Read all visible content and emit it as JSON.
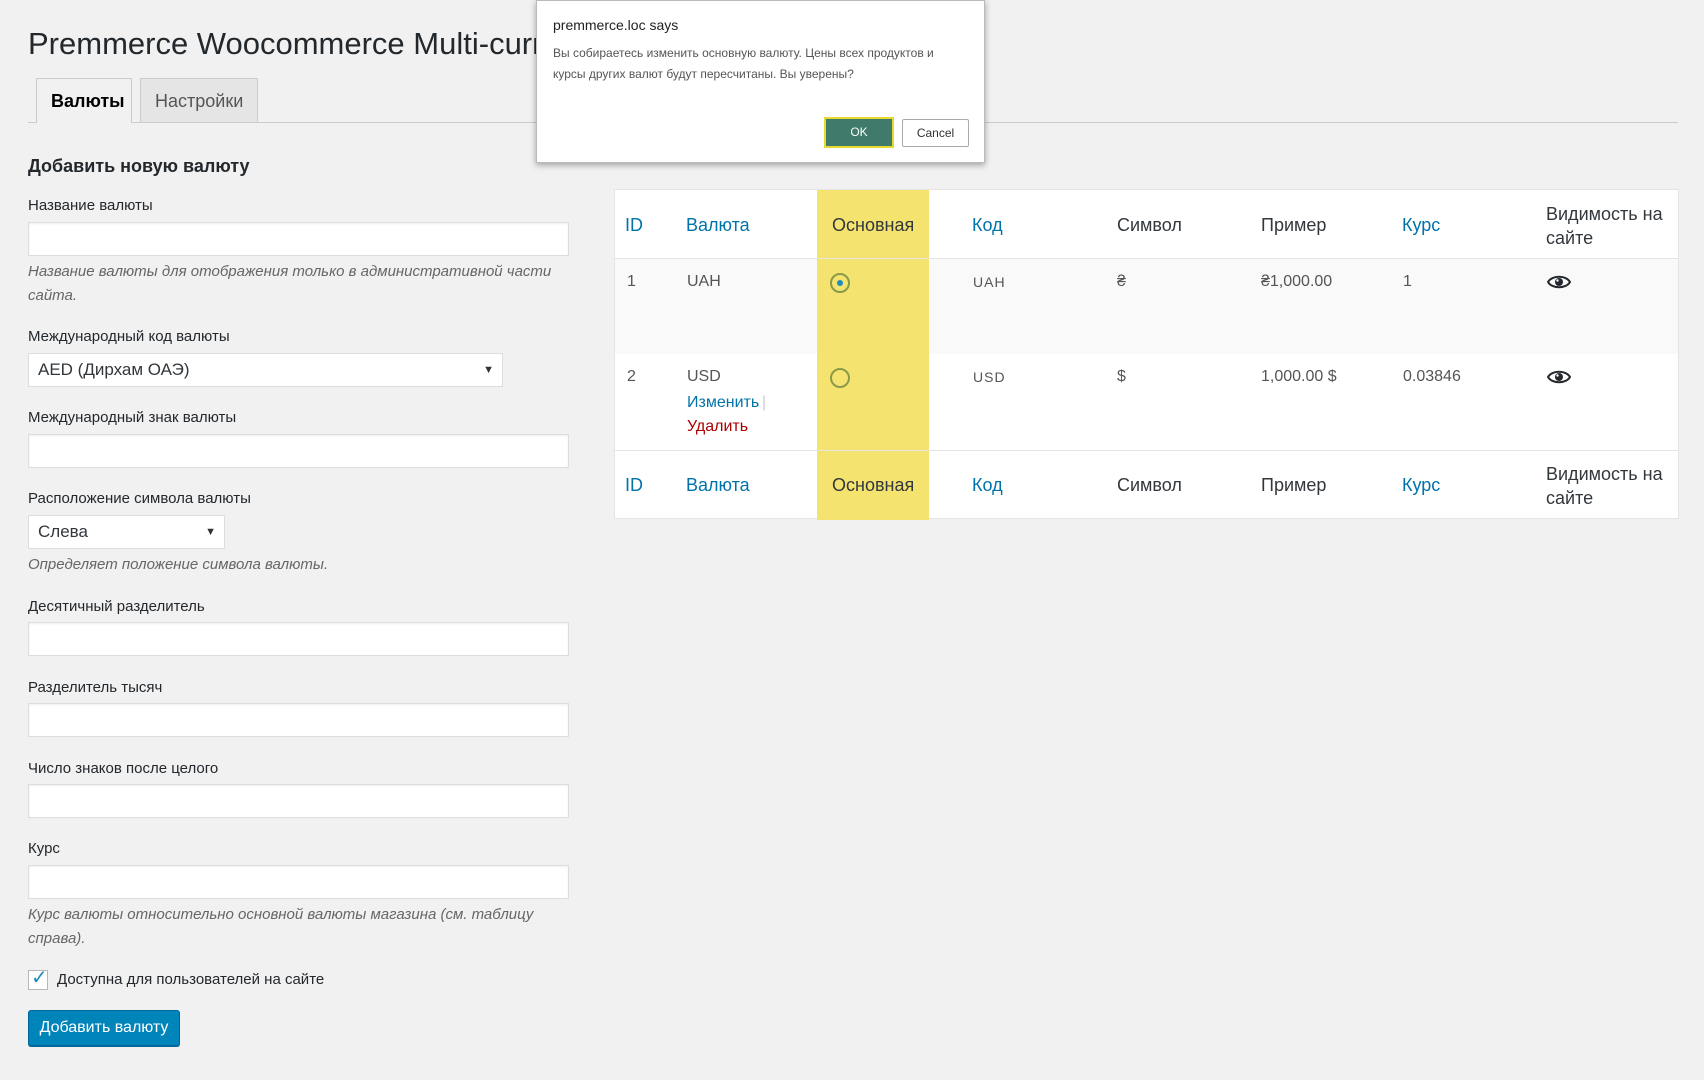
{
  "page": {
    "title": "Premmerce Woocommerce Multi-currency",
    "tabs": [
      {
        "label": "Валюты",
        "active": true
      },
      {
        "label": "Настройки",
        "active": false
      }
    ]
  },
  "form": {
    "heading": "Добавить новую валюту",
    "name_label": "Название валюты",
    "name_value": "",
    "name_desc": "Название валюты для отображения только в административной части сайта.",
    "code_label": "Международный код валюты",
    "code_value": "AED (Дирхам ОАЭ)",
    "symbol_label": "Международный знак валюты",
    "symbol_value": "",
    "position_label": "Расположение символа валюты",
    "position_value": "Слева",
    "position_desc": "Определяет положение символа валюты.",
    "decimal_label": "Десятичный разделитель",
    "thousand_label": "Разделитель тысяч",
    "decimals_label": "Число знаков после целого",
    "rate_label": "Курс",
    "rate_desc": "Курс валюты относительно основной валюты магазина (см. таблицу справа).",
    "available_label": "Доступна для пользователей на сайте",
    "available_checked": true,
    "submit_label": "Добавить валюту"
  },
  "table": {
    "columns": [
      "ID",
      "Валюта",
      "Основная",
      "Код",
      "Символ",
      "Пример",
      "Курс",
      "Видимость на сайте"
    ],
    "rows": [
      {
        "id": "1",
        "currency": "UAH",
        "main": true,
        "code": "UAH",
        "symbol": "₴",
        "example": "₴1,000.00",
        "rate": "1",
        "visible": "eye-icon"
      },
      {
        "id": "2",
        "currency": "USD",
        "main": false,
        "code": "USD",
        "symbol": "$",
        "example": "1,000.00 $",
        "rate": "0.03846",
        "visible": "eye-icon",
        "actions": {
          "edit": "Изменить",
          "separator": "|",
          "delete": "Удалить"
        }
      }
    ]
  },
  "dialog": {
    "title": "premmerce.loc says",
    "message": "Вы собираетесь изменить основную валюту. Цены всех продуктов и курсы других валют будут пересчитаны. Вы уверены?",
    "ok_label": "OK",
    "cancel_label": "Cancel"
  },
  "colors": {
    "link": "#0073aa",
    "delete": "#a00",
    "highlight_column": "#f4e36f",
    "primary_button": "#0085ba",
    "dialog_ok": "#3f7a6b"
  }
}
